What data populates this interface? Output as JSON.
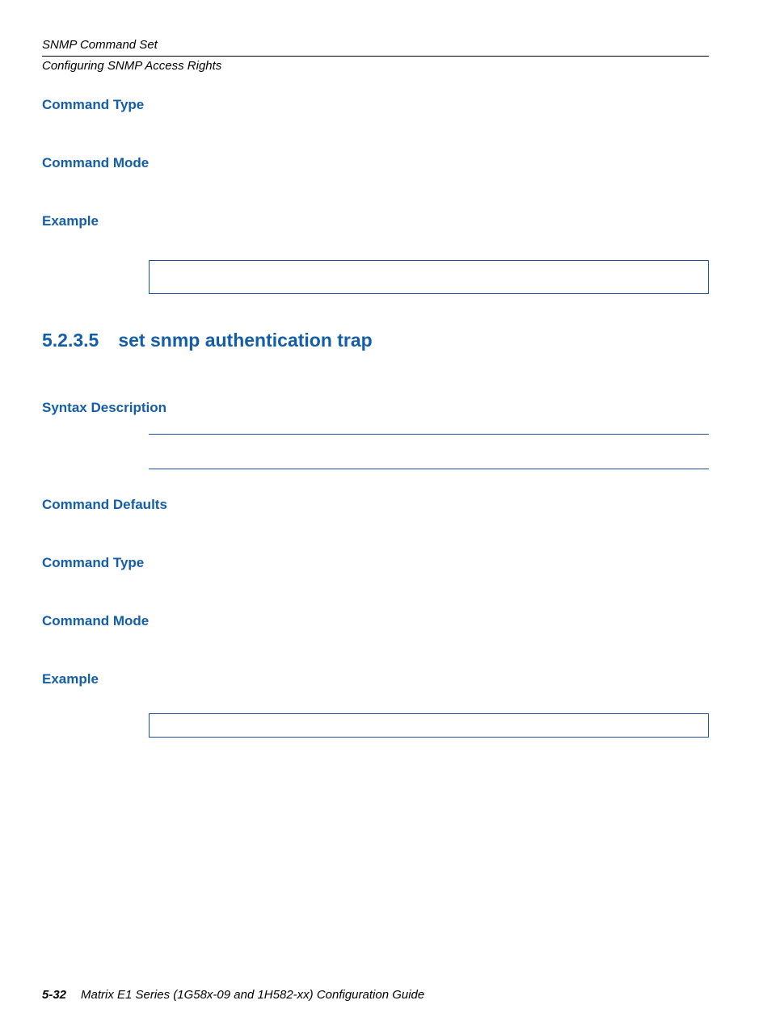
{
  "header": {
    "chapter": "SNMP Command Set",
    "section": "Configuring SNMP Access Rights"
  },
  "sections": {
    "command_type_1": "Command Type",
    "command_mode_1": "Command Mode",
    "example_1": "Example",
    "subsection_number": "5.2.3.5",
    "subsection_title": "set snmp authentication trap",
    "syntax_description": "Syntax Description",
    "command_defaults": "Command Defaults",
    "command_type_2": "Command Type",
    "command_mode_2": "Command Mode",
    "example_2": "Example"
  },
  "example_box_1": "",
  "example_box_2": "",
  "footer": {
    "page_number": "5-32",
    "doc_title": "Matrix E1 Series (1G58x-09 and 1H582-xx) Configuration Guide"
  },
  "chart_data": null
}
